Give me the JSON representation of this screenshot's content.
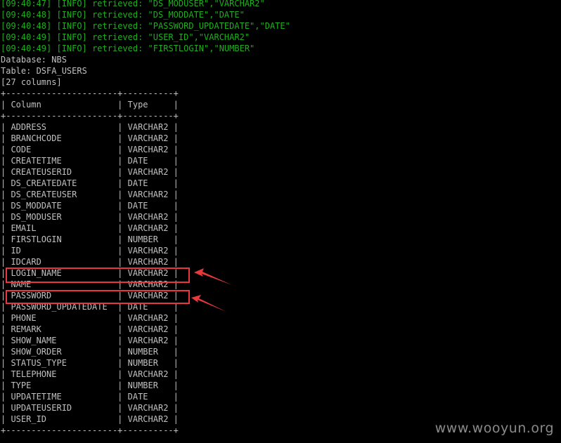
{
  "log_lines": [
    {
      "time": "[09:40:47]",
      "level": "[INFO]",
      "message": "retrieved: \"DS_MODUSER\",\"VARCHAR2\""
    },
    {
      "time": "[09:40:48]",
      "level": "[INFO]",
      "message": "retrieved: \"DS_MODDATE\",\"DATE\""
    },
    {
      "time": "[09:40:48]",
      "level": "[INFO]",
      "message": "retrieved: \"PASSWORD_UPDATEDATE\",\"DATE\""
    },
    {
      "time": "[09:40:49]",
      "level": "[INFO]",
      "message": "retrieved: \"USER_ID\",\"VARCHAR2\""
    },
    {
      "time": "[09:40:49]",
      "level": "[INFO]",
      "message": "retrieved: \"FIRSTLOGIN\",\"NUMBER\""
    }
  ],
  "database_line": "Database: NBS",
  "table_line": "Table: DSFA_USERS",
  "columns_count_line": "[27 columns]",
  "table": {
    "border_line": "+----------------------+----------+",
    "header_line": "| Column               | Type     |",
    "rows": [
      "| ADDRESS              | VARCHAR2 |",
      "| BRANCHCODE           | VARCHAR2 |",
      "| CODE                 | VARCHAR2 |",
      "| CREATETIME           | DATE     |",
      "| CREATEUSERID         | VARCHAR2 |",
      "| DS_CREATEDATE        | DATE     |",
      "| DS_CREATEUSER        | VARCHAR2 |",
      "| DS_MODDATE           | DATE     |",
      "| DS_MODUSER           | VARCHAR2 |",
      "| EMAIL                | VARCHAR2 |",
      "| FIRSTLOGIN           | NUMBER   |",
      "| ID                   | VARCHAR2 |",
      "| IDCARD               | VARCHAR2 |",
      "| LOGIN_NAME           | VARCHAR2 |",
      "| NAME                 | VARCHAR2 |",
      "| PASSWORD             | VARCHAR2 |",
      "| PASSWORD_UPDATEDATE  | DATE     |",
      "| PHONE                | VARCHAR2 |",
      "| REMARK               | VARCHAR2 |",
      "| SHOW_NAME            | VARCHAR2 |",
      "| SHOW_ORDER           | NUMBER   |",
      "| STATUS_TYPE          | NUMBER   |",
      "| TELEPHONE            | VARCHAR2 |",
      "| TYPE                 | NUMBER   |",
      "| UPDATETIME           | DATE     |",
      "| UPDATEUSERID         | VARCHAR2 |",
      "| USER_ID              | VARCHAR2 |"
    ]
  },
  "colors": {
    "background": "#000000",
    "log_text": "#1fae1f",
    "default_text": "#c0c0c0",
    "highlight": "#e8383d"
  },
  "watermark": "www.wooyun.org"
}
